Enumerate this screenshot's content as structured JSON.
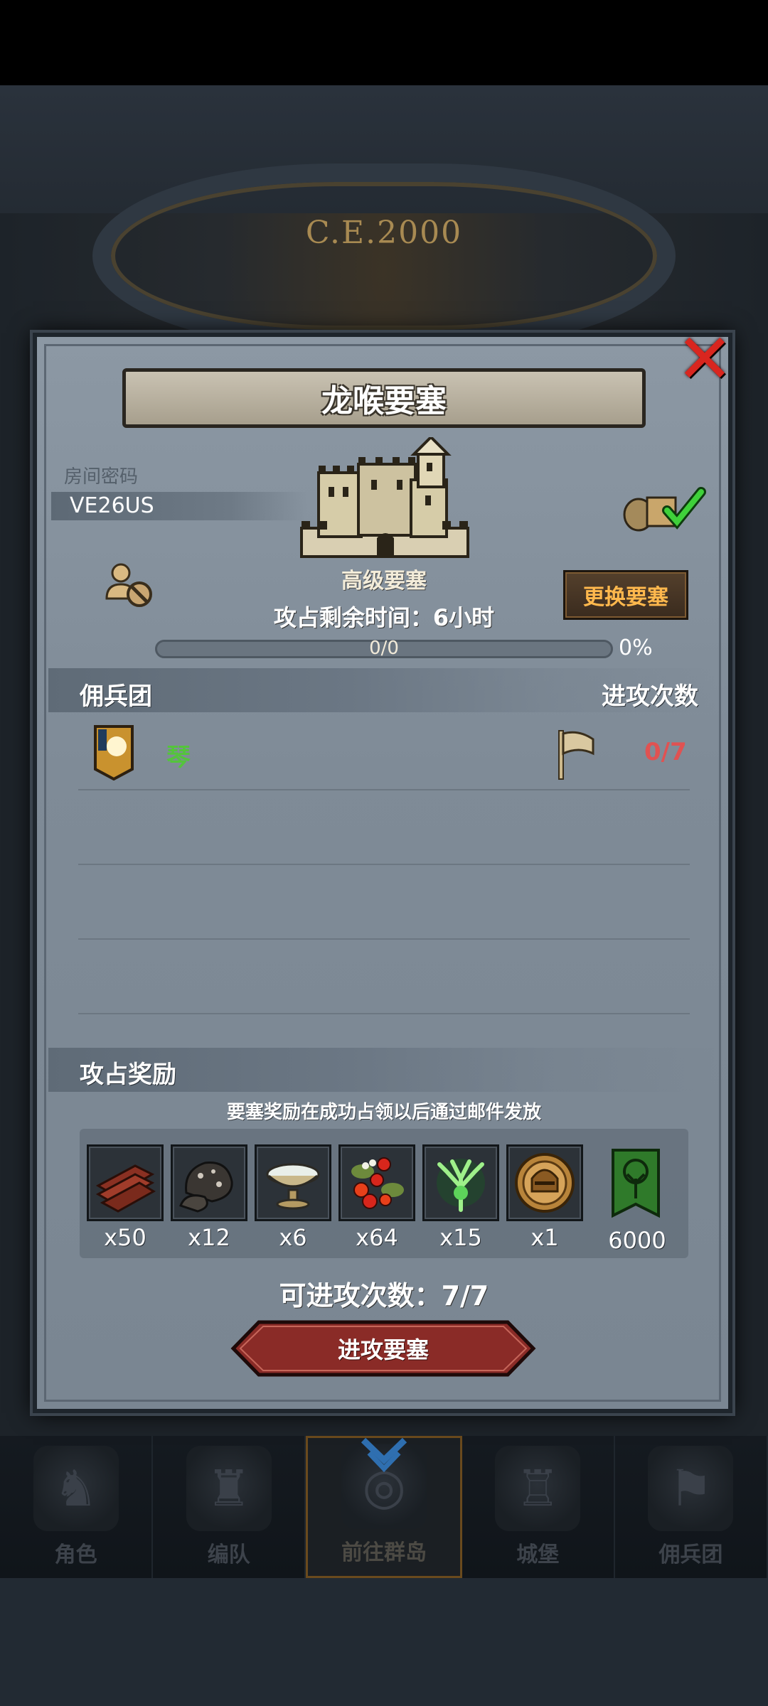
{
  "background": {
    "era": "C.E.2000"
  },
  "modal": {
    "title": "龙喉要塞",
    "room_label": "房间密码",
    "room_code": "VE26US",
    "fortress_name": "高级要塞",
    "change_button": "更换要塞",
    "timer_text": "攻占剩余时间：6小时",
    "progress_text": "0/0",
    "progress_fraction": 0,
    "progress_pct": "0%",
    "mercenary_section": {
      "title": "佣兵团",
      "right_title": "进攻次数",
      "rows": [
        {
          "name": "琴",
          "attacks": "0/7"
        }
      ]
    },
    "reward_section": {
      "title": "攻占奖励",
      "note": "要塞奖励在成功占领以后通过邮件发放",
      "items": [
        {
          "icon": "wood-planks-icon",
          "count": "x50"
        },
        {
          "icon": "ore-rock-icon",
          "count": "x12"
        },
        {
          "icon": "silver-bowl-icon",
          "count": "x6"
        },
        {
          "icon": "berries-icon",
          "count": "x64"
        },
        {
          "icon": "green-crystal-tree-icon",
          "count": "x15"
        },
        {
          "icon": "knight-helmet-coin-icon",
          "count": "x1"
        },
        {
          "icon": "tree-banner-icon",
          "count": "6000"
        }
      ]
    },
    "attacks_left": "可进攻次数：7/7",
    "attack_button": "进攻要塞"
  },
  "bottom_nav": {
    "items": [
      {
        "label": "角色",
        "icon": "character-icon"
      },
      {
        "label": "编队",
        "icon": "formation-icon"
      },
      {
        "label": "前往群岛",
        "icon": "islands-globe-icon",
        "active": true
      },
      {
        "label": "城堡",
        "icon": "castle-icon"
      },
      {
        "label": "佣兵团",
        "icon": "mercenary-icon"
      }
    ]
  },
  "colors": {
    "accent_red": "#d9261f",
    "button_orange": "#ffb84d",
    "merc_green": "#54c43c",
    "attack_count_red": "#e05252"
  }
}
